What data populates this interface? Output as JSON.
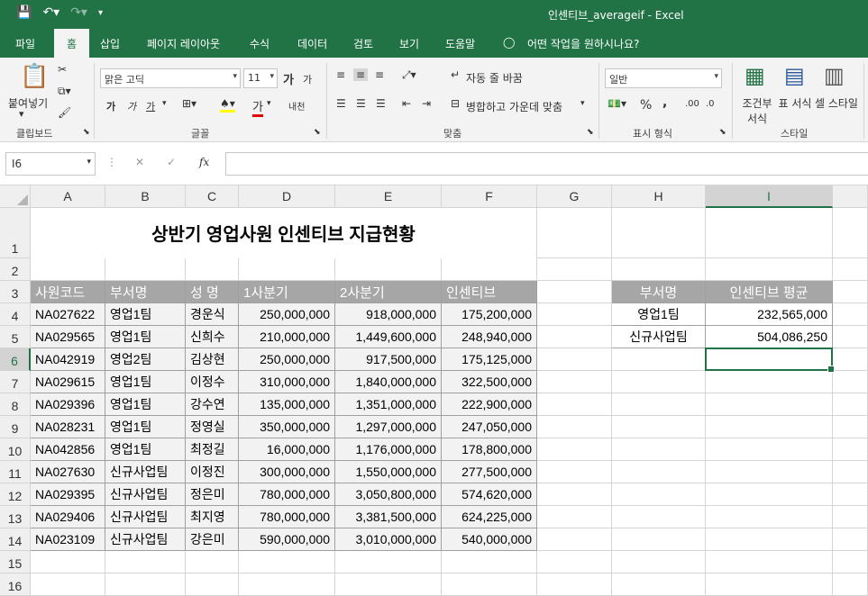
{
  "window": {
    "title": "인센티브_averageif - Excel"
  },
  "tabs": [
    "파일",
    "홈",
    "삽입",
    "페이지 레이아웃",
    "수식",
    "데이터",
    "검토",
    "보기",
    "도움말"
  ],
  "tell_me": "어떤 작업을 원하시나요?",
  "ribbon": {
    "clipboard": {
      "paste": "붙여넣기",
      "group": "클립보드"
    },
    "font": {
      "name": "맑은 고딕",
      "size": "11",
      "bold": "가",
      "italic": "가",
      "underline": "가",
      "group": "글꼴",
      "grow": "가",
      "shrink": "가",
      "phonetic": "내천"
    },
    "align": {
      "wrap": "자동 줄 바꿈",
      "merge": "병합하고 가운데 맞춤",
      "group": "맞춤"
    },
    "number": {
      "format": "일반",
      "percent": "%",
      "comma": ",",
      "group": "표시 형식"
    },
    "styles": {
      "conditional": "조건부 서식",
      "table": "표 서식",
      "cell": "셀 스타일",
      "group": "스타일"
    }
  },
  "formula_bar": {
    "namebox": "I6",
    "formula": ""
  },
  "columns": [
    "A",
    "B",
    "C",
    "D",
    "E",
    "F",
    "G",
    "H",
    "I"
  ],
  "rows": [
    "1",
    "2",
    "3",
    "4",
    "5",
    "6",
    "7",
    "8",
    "9",
    "10",
    "11",
    "12",
    "13",
    "14",
    "15",
    "16"
  ],
  "sheet": {
    "title": "상반기 영업사원 인센티브 지급현황",
    "headers": [
      "사원코드",
      "부서명",
      "성  명",
      "1사분기",
      "2사분기",
      "인센티브"
    ],
    "data": [
      [
        "NA027622",
        "영업1팀",
        "경운식",
        "250,000,000",
        "918,000,000",
        "175,200,000"
      ],
      [
        "NA029565",
        "영업1팀",
        "신희수",
        "210,000,000",
        "1,449,600,000",
        "248,940,000"
      ],
      [
        "NA042919",
        "영업2팀",
        "김상현",
        "250,000,000",
        "917,500,000",
        "175,125,000"
      ],
      [
        "NA029615",
        "영업1팀",
        "이정수",
        "310,000,000",
        "1,840,000,000",
        "322,500,000"
      ],
      [
        "NA029396",
        "영업1팀",
        "강수연",
        "135,000,000",
        "1,351,000,000",
        "222,900,000"
      ],
      [
        "NA028231",
        "영업1팀",
        "정영실",
        "350,000,000",
        "1,297,000,000",
        "247,050,000"
      ],
      [
        "NA042856",
        "영업1팀",
        "최정길",
        "16,000,000",
        "1,176,000,000",
        "178,800,000"
      ],
      [
        "NA027630",
        "신규사업팀",
        "이정진",
        "300,000,000",
        "1,550,000,000",
        "277,500,000"
      ],
      [
        "NA029395",
        "신규사업팀",
        "정은미",
        "780,000,000",
        "3,050,800,000",
        "574,620,000"
      ],
      [
        "NA029406",
        "신규사업팀",
        "최지영",
        "780,000,000",
        "3,381,500,000",
        "624,225,000"
      ],
      [
        "NA023109",
        "신규사업팀",
        "강은미",
        "590,000,000",
        "3,010,000,000",
        "540,000,000"
      ]
    ],
    "summary_headers": [
      "부서명",
      "인센티브 평균"
    ],
    "summary": [
      [
        "영업1팀",
        "232,565,000"
      ],
      [
        "신규사업팀",
        "504,086,250"
      ]
    ]
  },
  "colors": {
    "accent": "#217346",
    "header_fill": "#a6a6a6"
  }
}
